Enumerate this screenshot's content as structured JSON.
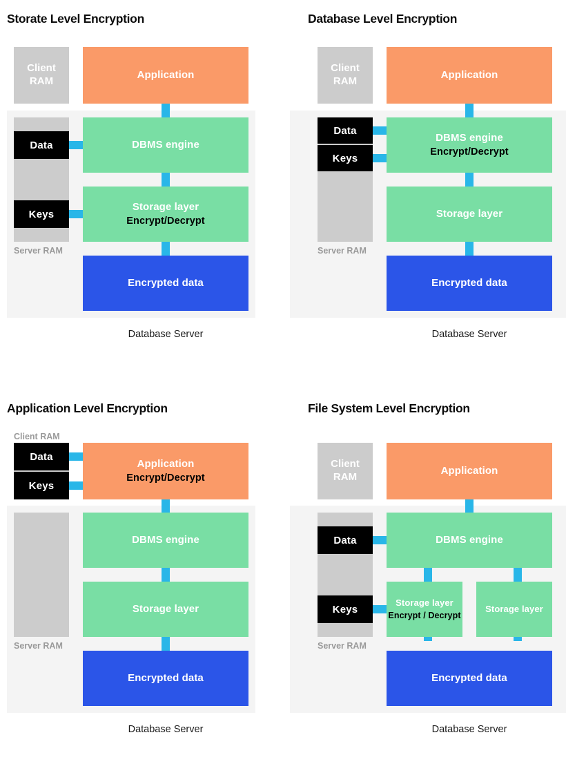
{
  "colors": {
    "application": "#fa9a68",
    "engine": "#79dea4",
    "encrypted": "#2b55e8",
    "connector": "#29b6e8",
    "ram": "#cccccc",
    "chip": "#000000",
    "server_region": "#f4f4f4",
    "ram_label": "#9a9a9a"
  },
  "common": {
    "client_ram_label": "Client RAM",
    "client_ram_line1": "Client",
    "client_ram_line2": "RAM",
    "server_ram_label": "Server RAM",
    "data_label": "Data",
    "keys_label": "Keys",
    "application_label": "Application",
    "dbms_label": "DBMS engine",
    "storage_label": "Storage layer",
    "encrypted_label": "Encrypted data",
    "encrypt_decrypt": "Encrypt/Decrypt",
    "encrypt_decrypt_spaced": "Encrypt / Decrypt",
    "database_server_caption": "Database Server"
  },
  "panels": [
    {
      "id": "storage-level",
      "title": "Storate Level Encryption",
      "client_ram_mode": "block",
      "client_ram_line1": "Client",
      "client_ram_line2": "RAM",
      "server_ram_label": "Server RAM",
      "chips": [
        "Data",
        "Keys"
      ],
      "application": {
        "label": "Application",
        "sub": ""
      },
      "dbms": {
        "label": "DBMS engine",
        "sub": ""
      },
      "storage": {
        "label": "Storage layer",
        "sub": "Encrypt/Decrypt"
      },
      "encrypted": {
        "label": "Encrypted data",
        "sub": ""
      },
      "caption": "Database Server"
    },
    {
      "id": "database-level",
      "title": "Database Level Encryption",
      "client_ram_mode": "block",
      "client_ram_line1": "Client",
      "client_ram_line2": "RAM",
      "server_ram_label": "Server RAM",
      "chips": [
        "Data",
        "Keys"
      ],
      "application": {
        "label": "Application",
        "sub": ""
      },
      "dbms": {
        "label": "DBMS engine",
        "sub": "Encrypt/Decrypt"
      },
      "storage": {
        "label": "Storage layer",
        "sub": ""
      },
      "encrypted": {
        "label": "Encrypted data",
        "sub": ""
      },
      "caption": "Database Server"
    },
    {
      "id": "application-level",
      "title": "Application Level Encryption",
      "client_ram_mode": "label",
      "client_ram_label": "Client RAM",
      "server_ram_label": "Server RAM",
      "chips": [
        "Data",
        "Keys"
      ],
      "application": {
        "label": "Application",
        "sub": "Encrypt/Decrypt"
      },
      "dbms": {
        "label": "DBMS engine",
        "sub": ""
      },
      "storage": {
        "label": "Storage layer",
        "sub": ""
      },
      "encrypted": {
        "label": "Encrypted data",
        "sub": ""
      },
      "caption": "Database Server"
    },
    {
      "id": "filesystem-level",
      "title": "File System Level Encryption",
      "client_ram_mode": "block",
      "client_ram_line1": "Client",
      "client_ram_line2": "RAM",
      "server_ram_label": "Server RAM",
      "chips": [
        "Data",
        "Keys"
      ],
      "application": {
        "label": "Application",
        "sub": ""
      },
      "dbms": {
        "label": "DBMS engine",
        "sub": ""
      },
      "storage_left": {
        "label": "Storage layer",
        "sub": "Encrypt / Decrypt"
      },
      "storage_right": {
        "label": "Storage layer",
        "sub": ""
      },
      "encrypted": {
        "label": "Encrypted data",
        "sub": ""
      },
      "caption": "Database Server"
    }
  ]
}
